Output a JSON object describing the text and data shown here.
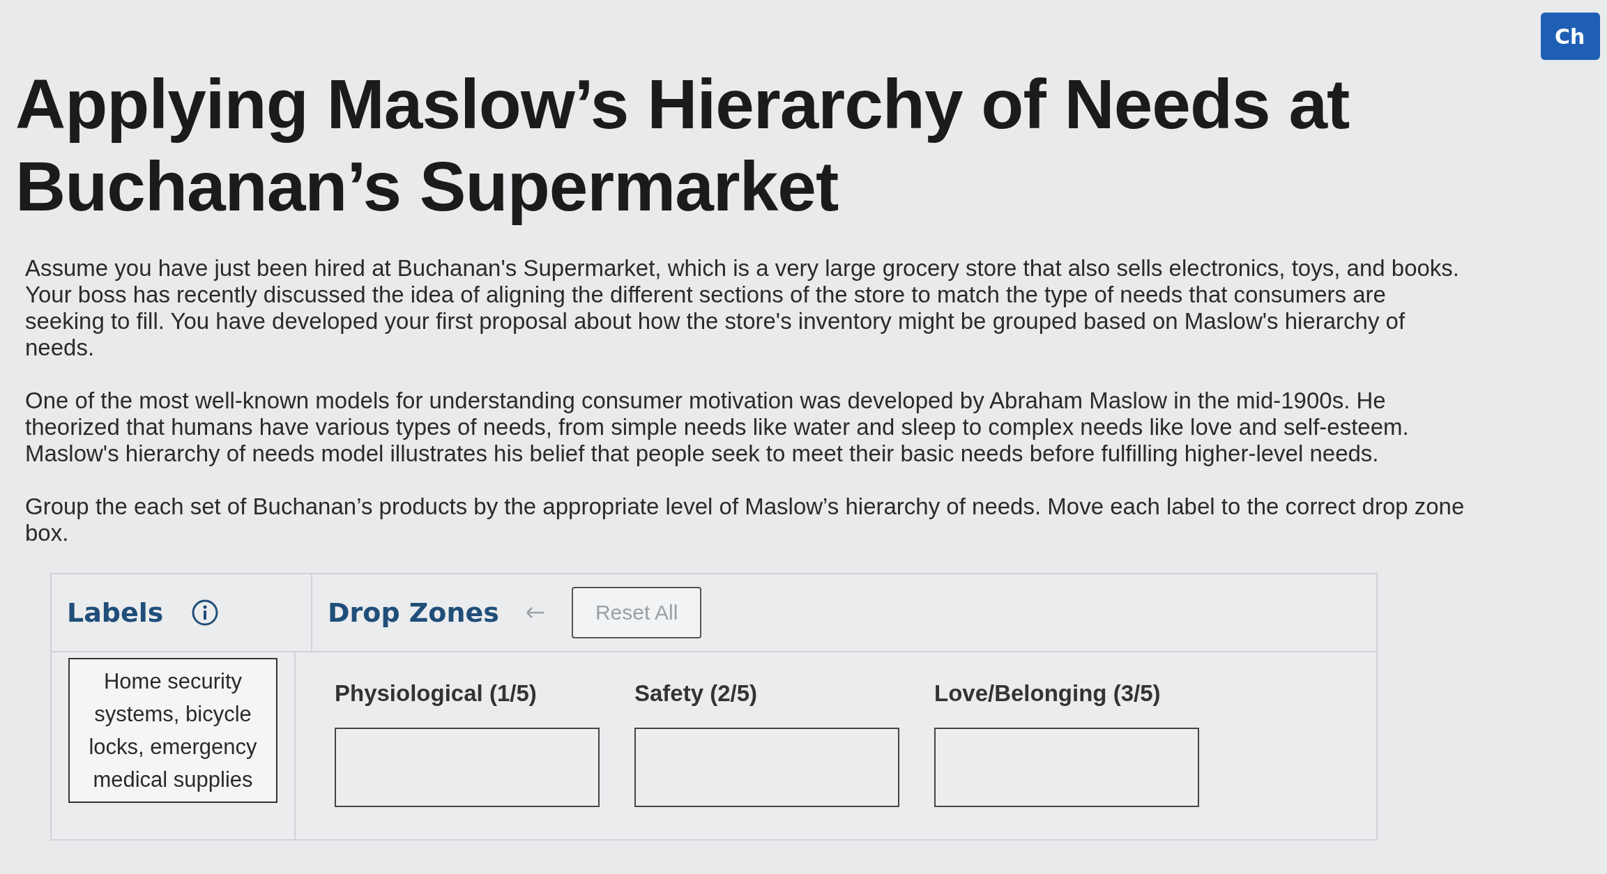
{
  "corner_button": {
    "label": "Ch"
  },
  "title": "Applying Maslow’s Hierarchy of Needs at Buchanan’s Supermarket",
  "paragraphs": [
    "Assume you have just been hired at Buchanan's Supermarket, which is a very large grocery store that also sells electronics, toys, and books. Your boss has recently discussed the idea of aligning the different sections of the store to match the type of needs that consumers are seeking to fill. You have developed your first proposal about how the store's inventory might be grouped based on Maslow's hierarchy of needs.",
    "One of the most well-known models for understanding consumer motivation was developed by Abraham Maslow in the mid-1900s. He theorized that humans have various types of needs, from simple needs like water and sleep to complex needs like love and self-esteem. Maslow's hierarchy of needs model illustrates his belief that people seek to meet their basic needs before fulfilling higher-level needs.",
    "Group the each set of Buchanan’s products by the appropriate level of Maslow’s hierarchy of needs. Move each label to the correct drop zone box."
  ],
  "activity": {
    "labels_heading": "Labels",
    "drop_zones_heading": "Drop Zones",
    "reset_button": "Reset All",
    "labels": [
      "Home security systems, bicycle locks, emergency medical supplies"
    ],
    "drop_zones": [
      {
        "title": "Physiological (1/5)"
      },
      {
        "title": "Safety (2/5)"
      },
      {
        "title": "Love/Belonging (3/5)"
      }
    ]
  }
}
